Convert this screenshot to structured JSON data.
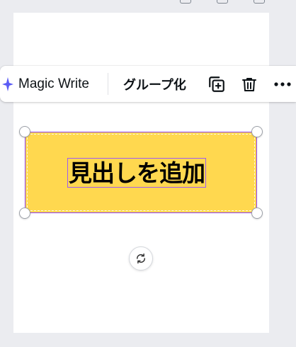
{
  "toolbar": {
    "magic_write_label": "Magic Write",
    "group_label": "グループ化",
    "copy_icon": "duplicate-icon",
    "delete_icon": "trash-icon",
    "more_icon": "more-icon"
  },
  "canvas": {
    "heading_text": "見出しを追加",
    "box_color": "#ffd84f",
    "selection_color": "#8b3dff"
  },
  "colors": {
    "accent": "#8b3dff",
    "magic_sparkle": "#5b5cf5",
    "page_bg": "#ffffff",
    "workspace_bg": "#ebecf0"
  }
}
